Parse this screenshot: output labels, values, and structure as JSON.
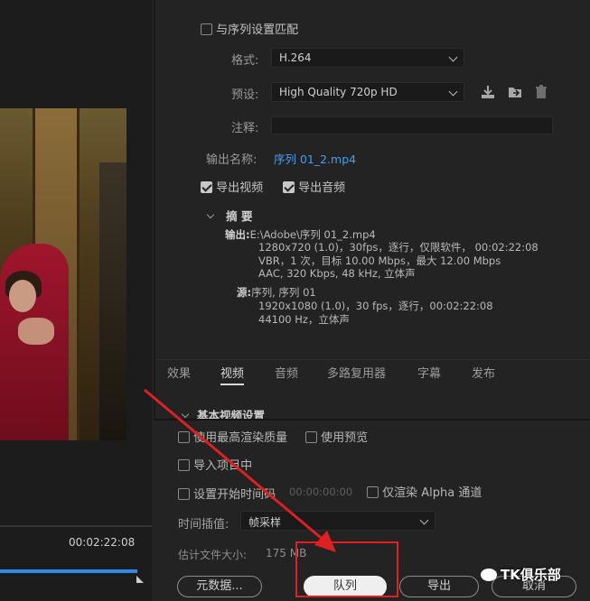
{
  "preview": {
    "timecode": "00:02:22:08",
    "progress": 0.97
  },
  "export": {
    "match_sequence_label": "与序列设置匹配",
    "match_sequence_checked": false,
    "format_label": "格式:",
    "format_value": "H.264",
    "preset_label": "预设:",
    "preset_value": "High Quality 720p HD",
    "comment_label": "注释:",
    "comment_value": "",
    "output_name_label": "输出名称:",
    "output_name_value": "序列 01_2.mp4",
    "export_video_label": "导出视频",
    "export_video_checked": true,
    "export_audio_label": "导出音频",
    "export_audio_checked": true
  },
  "summary": {
    "title": "摘 要",
    "output_key": "输出:",
    "output_path": "E:\\Adobe\\序列 01_2.mp4",
    "output_line2": "1280x720 (1.0)，30fps，逐行，仅限软件， 00:02:22:08",
    "output_line3": "VBR，1 次，目标 10.00 Mbps，最大 12.00 Mbps",
    "output_line4": "AAC, 320 Kbps, 48  kHz, 立体声",
    "source_key": "源:",
    "source_line1": "序列, 序列 01",
    "source_line2": "1920x1080 (1.0)，30 fps，逐行，00:02:22:08",
    "source_line3": "44100 Hz，立体声"
  },
  "tabs": [
    "效果",
    "视频",
    "音频",
    "多路复用器",
    "字幕",
    "发布"
  ],
  "active_tab": "视频",
  "video_section": {
    "heading": "基本视频设置"
  },
  "options": {
    "max_render_quality": "使用最高渲染质量",
    "use_previews": "使用预览",
    "import_into_project": "导入项目中",
    "set_start_timecode": "设置开始时间码",
    "start_timecode_value": "00:00:00:00",
    "render_alpha_only": "仅渲染 Alpha 通道",
    "time_interpolation_label": "时间插值:",
    "time_interpolation_value": "帧采样",
    "estimated_size_label": "估计文件大小:",
    "estimated_size_value": "175 MB"
  },
  "buttons": {
    "metadata": "元数据...",
    "queue": "队列",
    "export": "导出",
    "cancel": "取消"
  },
  "watermark": "TK俱乐部",
  "colors": {
    "accent_blue": "#2d8ceb",
    "link_blue": "#4a9eed",
    "annotation_red": "#e02020"
  }
}
